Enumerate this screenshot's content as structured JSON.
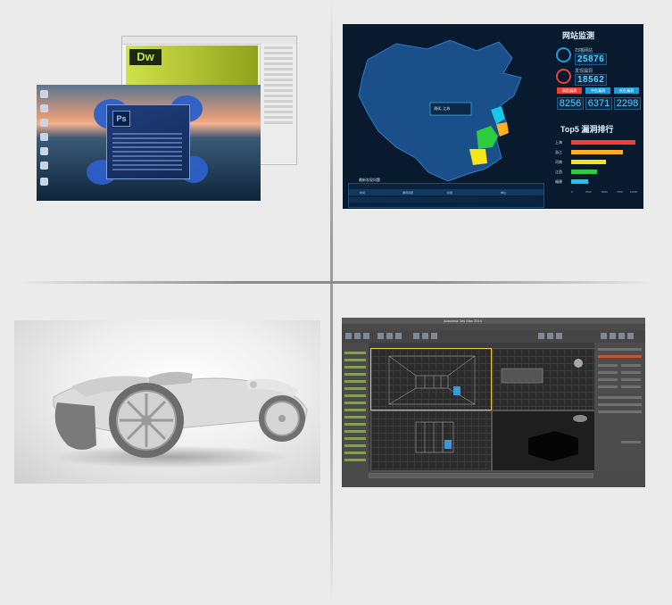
{
  "panels": {
    "software_desktop": {
      "dw_logo": "Dw",
      "ps_logo": "Ps"
    },
    "dashboard": {
      "title": "网站监测",
      "scanned_label": "扫描网站",
      "scanned_value": "25876",
      "vuln_label": "发现漏洞",
      "vuln_value": "18562",
      "kpis": [
        {
          "label": "高危漏洞",
          "value": "8256",
          "color": "#e8413c"
        },
        {
          "label": "中危漏洞",
          "value": "6371",
          "color": "#1e9ad6"
        },
        {
          "label": "低危漏洞",
          "value": "2298",
          "color": "#1e9ad6"
        }
      ],
      "top5_title": "Top5 漏洞排行",
      "top5": [
        {
          "name": "上海",
          "value": 8500,
          "color": "#ff3b30"
        },
        {
          "name": "浙江",
          "value": 6800,
          "color": "#ffb020"
        },
        {
          "name": "河南",
          "value": 4600,
          "color": "#f6e51a"
        },
        {
          "name": "江西",
          "value": 3400,
          "color": "#2ecc40"
        },
        {
          "name": "福建",
          "value": 2300,
          "color": "#18c8e8"
        }
      ],
      "axis_ticks": [
        "0",
        "2500",
        "5000",
        "7500",
        "10000"
      ],
      "tooltip": "测试, 江苏",
      "table_title": "最新发现问题",
      "table_headers": [
        "时间",
        "漏洞问题",
        "标题",
        "单位"
      ],
      "map_highlight_colors": [
        "#2ecc40",
        "#ffb020",
        "#18c8e8",
        "#f6e51a"
      ]
    },
    "car_render": {
      "color": "#dcdcdc"
    },
    "max_app": {
      "title": "Autodesk 3ds Max 2014"
    }
  }
}
